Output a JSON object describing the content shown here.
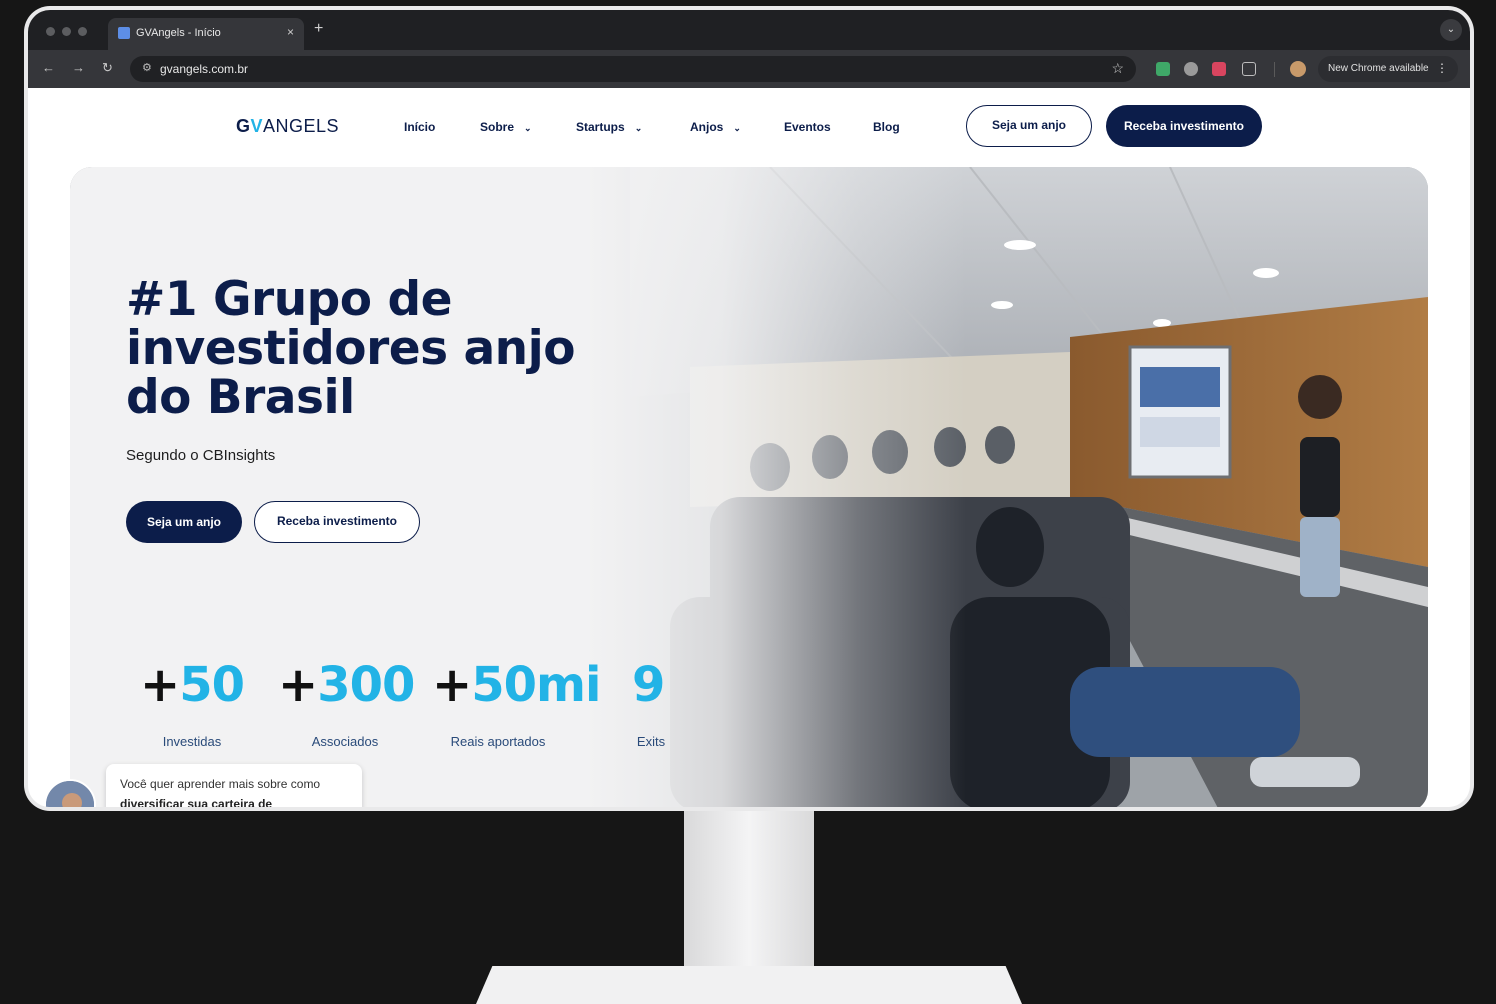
{
  "browser": {
    "tab_title": "GVAngels - Início",
    "tab_close": "×",
    "new_tab": "+",
    "url": "gvangels.com.br",
    "update_label": "New Chrome available",
    "update_menu": "⋮",
    "nav_back": "←",
    "nav_forward": "→",
    "nav_reload": "↻",
    "bookmark": "☆",
    "tab_menu": "⌄"
  },
  "site": {
    "logo": {
      "g": "G",
      "v": "V",
      "rest": "ANGELS"
    },
    "nav": [
      {
        "label": "Início",
        "chevron": ""
      },
      {
        "label": "Sobre",
        "chevron": "⌄"
      },
      {
        "label": "Startups",
        "chevron": "⌄"
      },
      {
        "label": "Anjos",
        "chevron": "⌄"
      },
      {
        "label": "Eventos",
        "chevron": ""
      },
      {
        "label": "Blog",
        "chevron": ""
      }
    ],
    "header_buttons": {
      "angel": "Seja um anjo",
      "investment": "Receba investimento"
    }
  },
  "hero": {
    "headline_lines": [
      "#1 Grupo de",
      "investidores anjo",
      "do Brasil"
    ],
    "subtitle": "Segundo o CBInsights",
    "cta_primary": "Seja um anjo",
    "cta_secondary": "Receba investimento"
  },
  "stats": [
    {
      "plus": "+",
      "value": "50",
      "label": "Investidas"
    },
    {
      "plus": "+",
      "value": "300",
      "label": "Associados"
    },
    {
      "plus": "+",
      "value": "50mi",
      "label": "Reais aportados"
    },
    {
      "plus": "",
      "value": "9",
      "label": "Exits"
    }
  ],
  "chat": {
    "line1": "Você quer aprender mais sobre como",
    "line2": "diversificar sua carteira de"
  },
  "colors": {
    "navy": "#0c1d4a",
    "accent": "#22b3e6"
  }
}
